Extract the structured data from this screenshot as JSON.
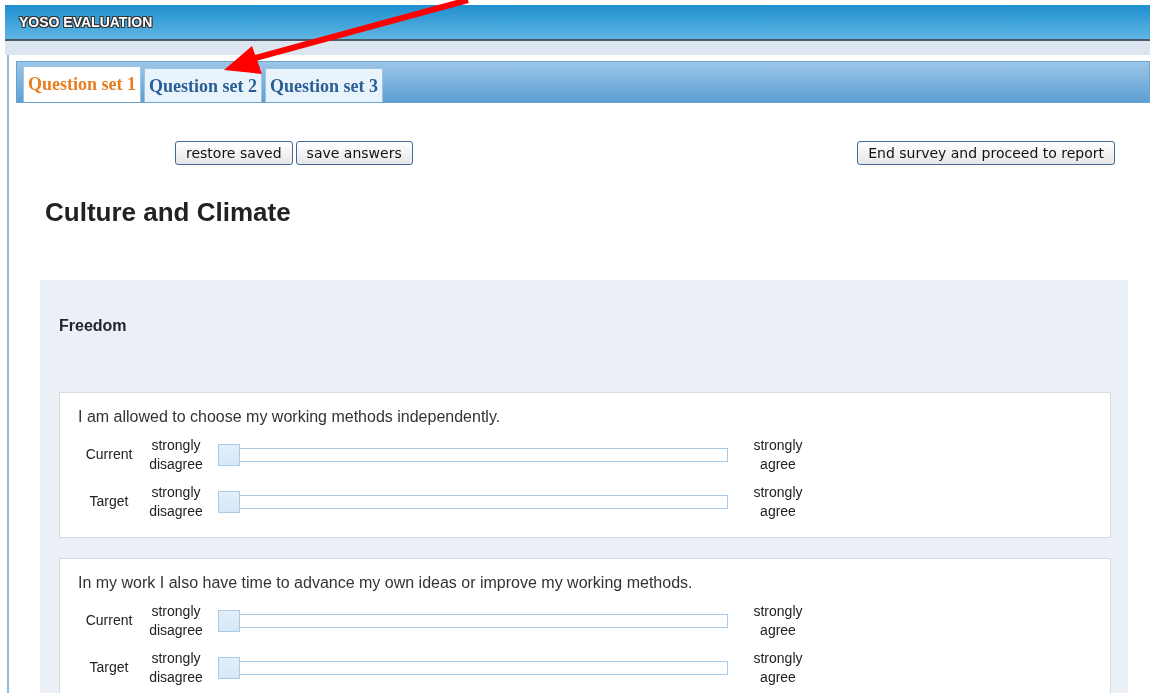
{
  "window": {
    "title": "YOSO EVALUATION"
  },
  "tabs": [
    {
      "label": "Question set 1",
      "selected": true
    },
    {
      "label": "Question set 2",
      "selected": false
    },
    {
      "label": "Question set 3",
      "selected": false
    }
  ],
  "left_buttons": [
    "restore saved",
    "save answers"
  ],
  "right_button": "End survey and proceed to report",
  "heading": "Culture and Climate",
  "section": {
    "title": "Freedom",
    "questions": [
      {
        "text": "I am allowed to choose my working methods independently.",
        "sliders": [
          {
            "label": "Current",
            "min_label": "strongly disagree",
            "max_label": "strongly agree",
            "level": 0
          },
          {
            "label": "Target",
            "min_label": "strongly disagree",
            "max_label": "strongly agree",
            "level": 0
          }
        ]
      },
      {
        "text": "In my work I also have time to advance my own ideas or improve my working methods.",
        "sliders": [
          {
            "label": "Current",
            "min_label": "strongly disagree",
            "max_label": "strongly agree",
            "level": 0
          },
          {
            "label": "Target",
            "min_label": "strongly disagree",
            "max_label": "strongly agree",
            "level": 0
          }
        ]
      }
    ]
  }
}
